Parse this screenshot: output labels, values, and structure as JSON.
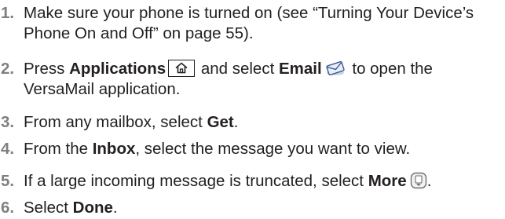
{
  "steps": [
    {
      "number": "1.",
      "line1": "Make sure your phone is turned on (see “Turning Your Device’s",
      "line2": "Phone On and Off” on page 55)."
    },
    {
      "number": "2.",
      "pre": "Press ",
      "bold1": "Applications",
      "icon1": "home-key-icon",
      "mid": " and select ",
      "bold2": "Email",
      "icon2": "email-envelope-icon",
      "post": " to open the",
      "line2": "VersaMail application."
    },
    {
      "number": "3.",
      "pre": "From any mailbox, select ",
      "bold": "Get",
      "post": "."
    },
    {
      "number": "4.",
      "pre": "From the ",
      "bold": "Inbox",
      "post": ", select the message you want to view."
    },
    {
      "number": "5.",
      "pre": "If a large incoming message is truncated, select ",
      "bold": "More",
      "icon": "more-scroll-icon",
      "post": "."
    },
    {
      "number": "6.",
      "pre": "Select ",
      "bold": "Done",
      "post": "."
    }
  ]
}
